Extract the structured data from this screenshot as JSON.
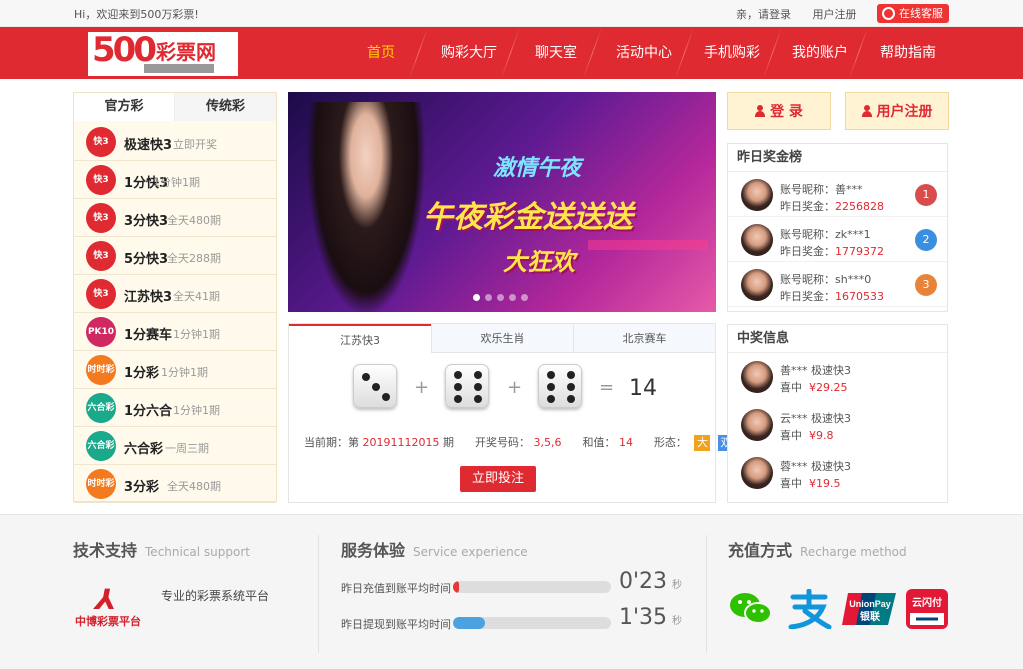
{
  "topbar": {
    "welcome": "Hi，欢迎来到500万彩票!",
    "login_prompt": "亲，请登录",
    "register": "用户注册",
    "service": "在线客服"
  },
  "logo": {
    "number": "500",
    "text": "彩票网"
  },
  "nav": {
    "items": [
      "首页",
      "购彩大厅",
      "聊天室",
      "活动中心",
      "手机购彩",
      "我的账户",
      "帮助指南"
    ],
    "active": "首页"
  },
  "lottery": {
    "tabs": [
      "官方彩",
      "传统彩"
    ],
    "items": [
      {
        "name": "极速快3",
        "desc": "立即开奖",
        "icon": "快3",
        "color": "#e02a32"
      },
      {
        "name": "1分快3",
        "desc": "1分钟1期",
        "icon": "快3",
        "color": "#e02a32"
      },
      {
        "name": "3分快3",
        "desc": "全天480期",
        "icon": "快3",
        "color": "#e02a32"
      },
      {
        "name": "5分快3",
        "desc": "全天288期",
        "icon": "快3",
        "color": "#e02a32"
      },
      {
        "name": "江苏快3",
        "desc": "全天41期",
        "icon": "快3",
        "color": "#e02a32"
      },
      {
        "name": "1分赛车",
        "desc": "1分钟1期",
        "icon": "PK10",
        "color": "#d02860"
      },
      {
        "name": "1分彩",
        "desc": "1分钟1期",
        "icon": "时时彩",
        "color": "#f47a20"
      },
      {
        "name": "1分六合",
        "desc": "1分钟1期",
        "icon": "六合彩",
        "color": "#1aa98a"
      },
      {
        "name": "六合彩",
        "desc": "一周三期",
        "icon": "六合彩",
        "color": "#1aa98a"
      },
      {
        "name": "3分彩",
        "desc": "全天480期",
        "icon": "时时彩",
        "color": "#f47a20"
      }
    ]
  },
  "banner": {
    "line1": "激情午夜",
    "line2": "午夜彩金送送送",
    "line3": "大狂欢"
  },
  "draw": {
    "tabs": [
      "江苏快3",
      "欢乐生肖",
      "北京赛车"
    ],
    "dice": [
      3,
      6,
      6
    ],
    "sum": "14",
    "period_label": "当前期：第",
    "period": "20191112015",
    "period_suffix": "期",
    "numbers_label": "开奖号码：",
    "numbers": "3,5,6",
    "sum_label": "和值：",
    "sum_value": "14",
    "form_label": "形态：",
    "form_big": "大",
    "form_even": "双",
    "bet_button": "立即投注"
  },
  "auth": {
    "login": "登 录",
    "register": "用户注册"
  },
  "rank": {
    "title": "昨日奖金榜",
    "nick_label": "账号昵称：",
    "prize_label": "昨日奖金：",
    "items": [
      {
        "nick": "善***",
        "prize": "2256828",
        "medal": "1",
        "color": "#d94c4c"
      },
      {
        "nick": "zk***1",
        "prize": "1779372",
        "medal": "2",
        "color": "#3b8fe0"
      },
      {
        "nick": "sh***0",
        "prize": "1670533",
        "medal": "3",
        "color": "#e8833a"
      }
    ]
  },
  "winners": {
    "title": "中奖信息",
    "won_label": "喜中",
    "items": [
      {
        "user": "善***",
        "game": "极速快3",
        "amount": "¥29.25"
      },
      {
        "user": "云***",
        "game": "极速快3",
        "amount": "¥9.8"
      },
      {
        "user": "蓉***",
        "game": "极速快3",
        "amount": "¥19.5"
      }
    ]
  },
  "footer": {
    "tech": {
      "title": "技术支持",
      "en": "Technical support",
      "brand": "中博彩票平台",
      "desc": "专业的彩票系统平台"
    },
    "service": {
      "title": "服务体验",
      "en": "Service experience",
      "rows": [
        {
          "label": "昨日充值到账平均时间",
          "time": "0'23",
          "unit": "秒",
          "progress": 0.04,
          "color": "#e53935"
        },
        {
          "label": "昨日提现到账平均时间",
          "time": "1'35",
          "unit": "秒",
          "progress": 0.2,
          "color": "#4aa3df"
        }
      ]
    },
    "recharge": {
      "title": "充值方式",
      "en": "Recharge method",
      "methods": [
        "wechat-pay-icon",
        "alipay-icon",
        "unionpay-icon",
        "cloud-pay-icon"
      ],
      "unionpay_text": "UnionPay",
      "unionpay_cn": "银联",
      "cloudpay_text": "云闪付"
    }
  }
}
